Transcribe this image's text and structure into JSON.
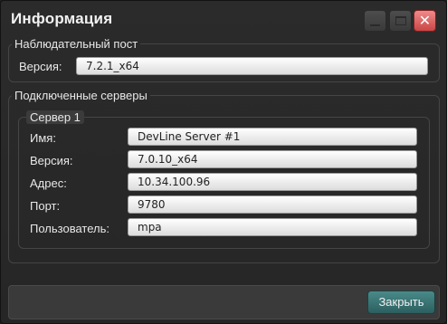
{
  "window": {
    "title": "Информация"
  },
  "title_buttons": {
    "minimize_icon": "minimize-icon",
    "maximize_icon": "maximize-icon",
    "close_icon": "close-icon",
    "close_color": "#d05555"
  },
  "observation_post": {
    "legend": "Наблюдательный пост",
    "version_label": "Версия:",
    "version_value": "7.2.1_x64"
  },
  "connected_servers": {
    "legend": "Подключенные серверы",
    "server1": {
      "legend": "Сервер 1",
      "fields": [
        {
          "label": "Имя:",
          "value": "DevLine Server #1"
        },
        {
          "label": "Версия:",
          "value": "7.0.10_x64"
        },
        {
          "label": "Адрес:",
          "value": "10.34.100.96"
        },
        {
          "label": "Порт:",
          "value": "9780"
        },
        {
          "label": "Пользователь:",
          "value": "mpa"
        }
      ]
    }
  },
  "footer": {
    "close_button": "Закрыть",
    "accent": "#3c7676"
  }
}
